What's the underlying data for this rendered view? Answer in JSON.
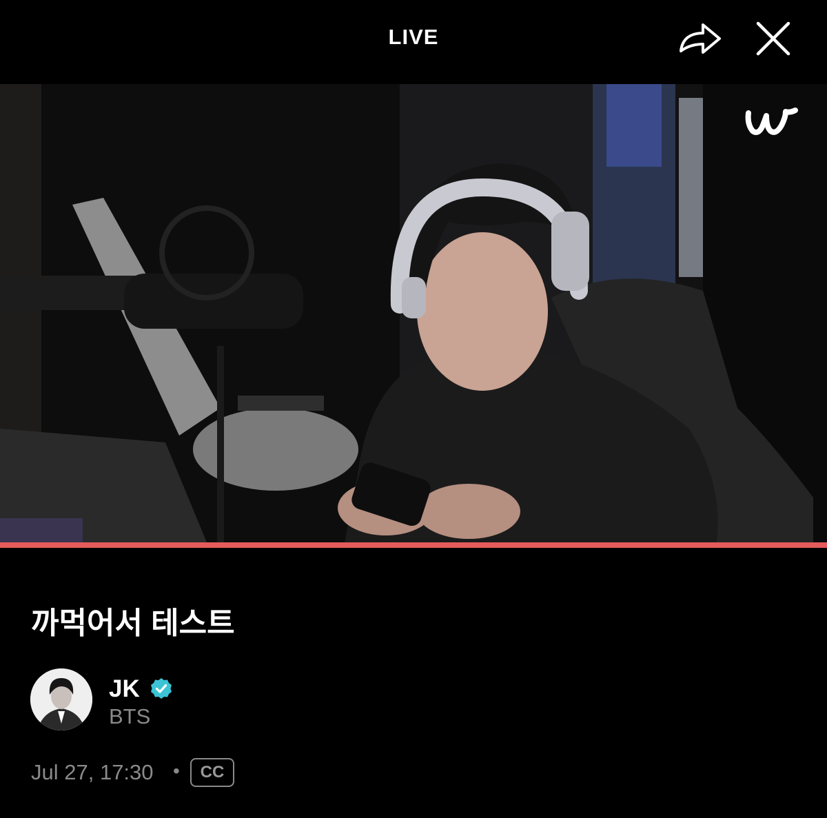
{
  "header": {
    "title": "LIVE",
    "share_icon": "share-arrow-icon",
    "close_icon": "close-icon"
  },
  "player": {
    "logo_icon": "weverse-logo-icon",
    "progress_fraction": 1.0,
    "progress_color": "#e55b5b"
  },
  "post": {
    "title": "까먹어서 테스트",
    "author": {
      "name": "JK",
      "group": "BTS",
      "verified_icon": "verified-badge-icon",
      "verified_color": "#3cc3d6"
    },
    "date": "Jul 27, 17:30",
    "separator": "•",
    "cc_label": "CC"
  }
}
